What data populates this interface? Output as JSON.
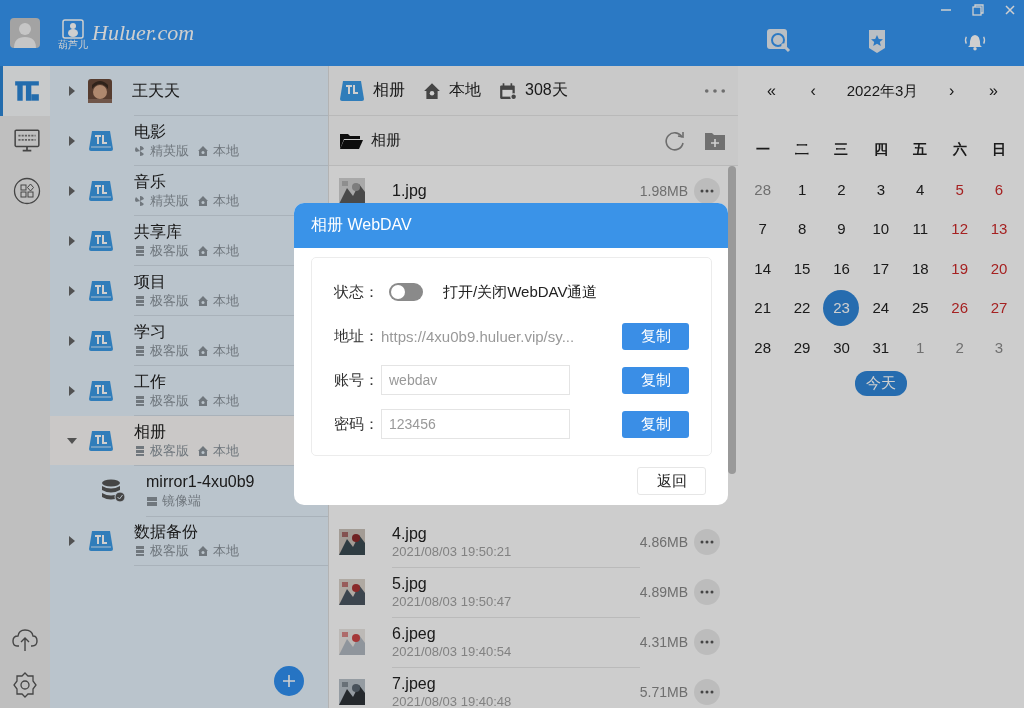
{
  "window": {
    "logo_caption": "葫芦儿",
    "logo_text": "Huluer.com"
  },
  "rail": [
    {
      "kind": "library",
      "selected": true
    },
    {
      "kind": "binary",
      "selected": false
    },
    {
      "kind": "apps",
      "selected": false
    }
  ],
  "rail_bottom": [
    {
      "kind": "upload"
    },
    {
      "kind": "settings"
    }
  ],
  "tree": [
    {
      "kind": "person",
      "name": "王天天",
      "expanded": false,
      "selected": false
    },
    {
      "kind": "drive",
      "name": "电影",
      "edition": {
        "kind": "elite",
        "label": "精英版"
      },
      "location": "本地",
      "expanded": false,
      "selected": false
    },
    {
      "kind": "drive",
      "name": "音乐",
      "edition": {
        "kind": "elite",
        "label": "精英版"
      },
      "location": "本地",
      "expanded": false,
      "selected": false
    },
    {
      "kind": "drive",
      "name": "共享库",
      "edition": {
        "kind": "geek",
        "label": "极客版"
      },
      "location": "本地",
      "expanded": false,
      "selected": false
    },
    {
      "kind": "drive",
      "name": "项目",
      "edition": {
        "kind": "geek",
        "label": "极客版"
      },
      "location": "本地",
      "expanded": false,
      "selected": false
    },
    {
      "kind": "drive",
      "name": "学习",
      "edition": {
        "kind": "geek",
        "label": "极客版"
      },
      "location": "本地",
      "expanded": false,
      "selected": false
    },
    {
      "kind": "drive",
      "name": "工作",
      "edition": {
        "kind": "geek",
        "label": "极客版"
      },
      "location": "本地",
      "expanded": false,
      "selected": false
    },
    {
      "kind": "drive",
      "name": "相册",
      "edition": {
        "kind": "geek",
        "label": "极客版"
      },
      "location": "本地",
      "expanded": true,
      "selected": true,
      "children": [
        {
          "name": "mirror1-4xu0b9",
          "role": "镜像端"
        }
      ]
    },
    {
      "kind": "drive",
      "name": "数据备份",
      "edition": {
        "kind": "geek",
        "label": "极客版"
      },
      "location": "本地",
      "expanded": false,
      "selected": false
    }
  ],
  "files_panel": {
    "drive": "相册",
    "location": "本地",
    "days": "308天",
    "folder": "相册",
    "files": [
      {
        "name": "1.jpg",
        "size": "1.98MB"
      },
      {
        "name": "4.jpg",
        "date": "2021/08/03 19:50:21",
        "size": "4.86MB"
      },
      {
        "name": "5.jpg",
        "date": "2021/08/03 19:50:47",
        "size": "4.89MB"
      },
      {
        "name": "6.jpeg",
        "date": "2021/08/03 19:40:54",
        "size": "4.31MB"
      },
      {
        "name": "7.jpeg",
        "date": "2021/08/03 19:40:48",
        "size": "5.71MB"
      }
    ]
  },
  "calendar": {
    "prev_year": "«",
    "prev_month": "‹",
    "month": "2022年3月",
    "next_month": "›",
    "next_year": "»",
    "weekdays": [
      "一",
      "二",
      "三",
      "四",
      "五",
      "六",
      "日"
    ],
    "weeks": [
      [
        {
          "label": "28",
          "muted": true,
          "weekend": false,
          "selected": false
        },
        {
          "label": "1",
          "muted": false,
          "weekend": false,
          "selected": false
        },
        {
          "label": "2",
          "muted": false,
          "weekend": false,
          "selected": false
        },
        {
          "label": "3",
          "muted": false,
          "weekend": false,
          "selected": false
        },
        {
          "label": "4",
          "muted": false,
          "weekend": false,
          "selected": false
        },
        {
          "label": "5",
          "muted": false,
          "weekend": true,
          "selected": false
        },
        {
          "label": "6",
          "muted": false,
          "weekend": true,
          "selected": false
        }
      ],
      [
        {
          "label": "7",
          "muted": false,
          "weekend": false,
          "selected": false
        },
        {
          "label": "8",
          "muted": false,
          "weekend": false,
          "selected": false
        },
        {
          "label": "9",
          "muted": false,
          "weekend": false,
          "selected": false
        },
        {
          "label": "10",
          "muted": false,
          "weekend": false,
          "selected": false
        },
        {
          "label": "11",
          "muted": false,
          "weekend": false,
          "selected": false
        },
        {
          "label": "12",
          "muted": false,
          "weekend": true,
          "selected": false
        },
        {
          "label": "13",
          "muted": false,
          "weekend": true,
          "selected": false
        }
      ],
      [
        {
          "label": "14",
          "muted": false,
          "weekend": false,
          "selected": false
        },
        {
          "label": "15",
          "muted": false,
          "weekend": false,
          "selected": false
        },
        {
          "label": "16",
          "muted": false,
          "weekend": false,
          "selected": false
        },
        {
          "label": "17",
          "muted": false,
          "weekend": false,
          "selected": false
        },
        {
          "label": "18",
          "muted": false,
          "weekend": false,
          "selected": false
        },
        {
          "label": "19",
          "muted": false,
          "weekend": true,
          "selected": false
        },
        {
          "label": "20",
          "muted": false,
          "weekend": true,
          "selected": false
        }
      ],
      [
        {
          "label": "21",
          "muted": false,
          "weekend": false,
          "selected": false
        },
        {
          "label": "22",
          "muted": false,
          "weekend": false,
          "selected": false
        },
        {
          "label": "23",
          "muted": false,
          "weekend": false,
          "selected": true
        },
        {
          "label": "24",
          "muted": false,
          "weekend": false,
          "selected": false
        },
        {
          "label": "25",
          "muted": false,
          "weekend": false,
          "selected": false
        },
        {
          "label": "26",
          "muted": false,
          "weekend": true,
          "selected": false
        },
        {
          "label": "27",
          "muted": false,
          "weekend": true,
          "selected": false
        }
      ],
      [
        {
          "label": "28",
          "muted": false,
          "weekend": false,
          "selected": false
        },
        {
          "label": "29",
          "muted": false,
          "weekend": false,
          "selected": false
        },
        {
          "label": "30",
          "muted": false,
          "weekend": false,
          "selected": false
        },
        {
          "label": "31",
          "muted": false,
          "weekend": false,
          "selected": false
        },
        {
          "label": "1",
          "muted": true,
          "weekend": false,
          "selected": false
        },
        {
          "label": "2",
          "muted": true,
          "weekend": false,
          "selected": false
        },
        {
          "label": "3",
          "muted": true,
          "weekend": false,
          "selected": false
        }
      ]
    ],
    "today_button": "今天"
  },
  "dialog": {
    "title": "相册 WebDAV",
    "status_label": "状态：",
    "toggle_on": false,
    "toggle_text": "打开/关闭WebDAV通道",
    "fields": [
      {
        "kind": "text",
        "label": "地址：",
        "value": "https://4xu0b9.huluer.vip/sy...",
        "button": "复制"
      },
      {
        "kind": "input",
        "label": "账号：",
        "value": "webdav",
        "button": "复制"
      },
      {
        "kind": "input",
        "label": "密码：",
        "value": "123456",
        "button": "复制"
      }
    ],
    "back_button": "返回"
  }
}
